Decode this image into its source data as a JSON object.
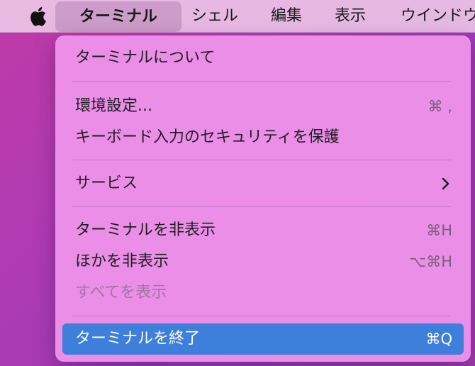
{
  "menubar": {
    "apple_icon": "apple-logo-icon",
    "items": [
      "ターミナル",
      "シェル",
      "編集",
      "表示",
      "ウインドウ"
    ]
  },
  "menu": {
    "items": [
      {
        "label": "ターミナルについて",
        "shortcut": ""
      },
      {
        "label": "環境設定...",
        "shortcut": "⌘ ,"
      },
      {
        "label": "キーボード入力のセキュリティを保護",
        "shortcut": ""
      },
      {
        "label": "サービス",
        "submenu_icon": "chevron-right-icon"
      },
      {
        "label": "ターミナルを非表示",
        "shortcut": "⌘H"
      },
      {
        "label": "ほかを非表示",
        "shortcut": "⌥⌘H"
      },
      {
        "label": "すべてを表示",
        "shortcut": ""
      },
      {
        "label": "ターミナルを終了",
        "shortcut": "⌘Q"
      }
    ]
  },
  "colors": {
    "highlight": "#3d7fdb",
    "menu_background": "#f096eb",
    "desktop": "#b13bb3"
  }
}
